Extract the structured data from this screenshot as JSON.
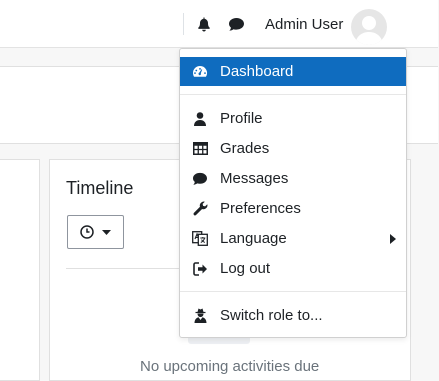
{
  "header": {
    "username": "Admin User",
    "icons": [
      "bell-icon",
      "chat-icon"
    ]
  },
  "timeline": {
    "title": "Timeline",
    "empty_text": "No upcoming activities due"
  },
  "user_menu": {
    "items": [
      {
        "label": "Dashboard",
        "icon": "dashboard-icon",
        "active": true
      },
      {
        "label": "Profile",
        "icon": "user-icon"
      },
      {
        "label": "Grades",
        "icon": "table-icon"
      },
      {
        "label": "Messages",
        "icon": "chat-icon"
      },
      {
        "label": "Preferences",
        "icon": "wrench-icon"
      },
      {
        "label": "Language",
        "icon": "language-icon",
        "submenu": true
      },
      {
        "label": "Log out",
        "icon": "logout-icon"
      },
      {
        "label": "Switch role to...",
        "icon": "user-secret-icon"
      }
    ],
    "active_color": "#0f6cbf"
  }
}
